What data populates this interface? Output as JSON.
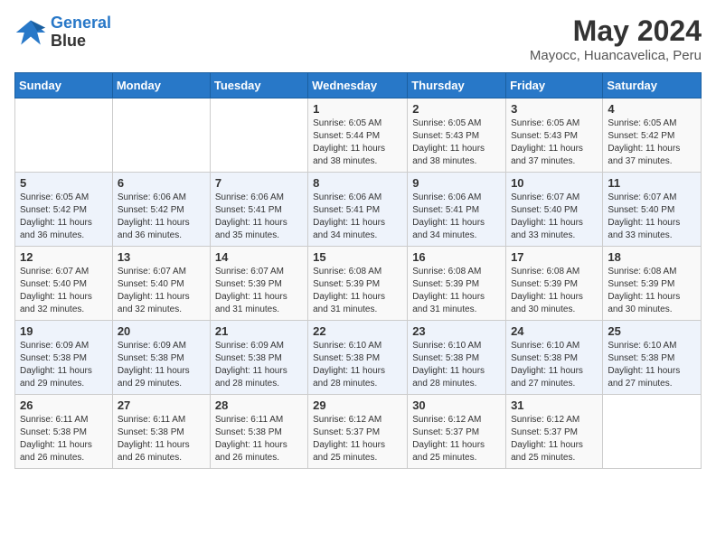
{
  "logo": {
    "line1": "General",
    "line2": "Blue"
  },
  "title": "May 2024",
  "location": "Mayocc, Huancavelica, Peru",
  "weekdays": [
    "Sunday",
    "Monday",
    "Tuesday",
    "Wednesday",
    "Thursday",
    "Friday",
    "Saturday"
  ],
  "weeks": [
    [
      {
        "day": "",
        "info": ""
      },
      {
        "day": "",
        "info": ""
      },
      {
        "day": "",
        "info": ""
      },
      {
        "day": "1",
        "info": "Sunrise: 6:05 AM\nSunset: 5:44 PM\nDaylight: 11 hours\nand 38 minutes."
      },
      {
        "day": "2",
        "info": "Sunrise: 6:05 AM\nSunset: 5:43 PM\nDaylight: 11 hours\nand 38 minutes."
      },
      {
        "day": "3",
        "info": "Sunrise: 6:05 AM\nSunset: 5:43 PM\nDaylight: 11 hours\nand 37 minutes."
      },
      {
        "day": "4",
        "info": "Sunrise: 6:05 AM\nSunset: 5:42 PM\nDaylight: 11 hours\nand 37 minutes."
      }
    ],
    [
      {
        "day": "5",
        "info": "Sunrise: 6:05 AM\nSunset: 5:42 PM\nDaylight: 11 hours\nand 36 minutes."
      },
      {
        "day": "6",
        "info": "Sunrise: 6:06 AM\nSunset: 5:42 PM\nDaylight: 11 hours\nand 36 minutes."
      },
      {
        "day": "7",
        "info": "Sunrise: 6:06 AM\nSunset: 5:41 PM\nDaylight: 11 hours\nand 35 minutes."
      },
      {
        "day": "8",
        "info": "Sunrise: 6:06 AM\nSunset: 5:41 PM\nDaylight: 11 hours\nand 34 minutes."
      },
      {
        "day": "9",
        "info": "Sunrise: 6:06 AM\nSunset: 5:41 PM\nDaylight: 11 hours\nand 34 minutes."
      },
      {
        "day": "10",
        "info": "Sunrise: 6:07 AM\nSunset: 5:40 PM\nDaylight: 11 hours\nand 33 minutes."
      },
      {
        "day": "11",
        "info": "Sunrise: 6:07 AM\nSunset: 5:40 PM\nDaylight: 11 hours\nand 33 minutes."
      }
    ],
    [
      {
        "day": "12",
        "info": "Sunrise: 6:07 AM\nSunset: 5:40 PM\nDaylight: 11 hours\nand 32 minutes."
      },
      {
        "day": "13",
        "info": "Sunrise: 6:07 AM\nSunset: 5:40 PM\nDaylight: 11 hours\nand 32 minutes."
      },
      {
        "day": "14",
        "info": "Sunrise: 6:07 AM\nSunset: 5:39 PM\nDaylight: 11 hours\nand 31 minutes."
      },
      {
        "day": "15",
        "info": "Sunrise: 6:08 AM\nSunset: 5:39 PM\nDaylight: 11 hours\nand 31 minutes."
      },
      {
        "day": "16",
        "info": "Sunrise: 6:08 AM\nSunset: 5:39 PM\nDaylight: 11 hours\nand 31 minutes."
      },
      {
        "day": "17",
        "info": "Sunrise: 6:08 AM\nSunset: 5:39 PM\nDaylight: 11 hours\nand 30 minutes."
      },
      {
        "day": "18",
        "info": "Sunrise: 6:08 AM\nSunset: 5:39 PM\nDaylight: 11 hours\nand 30 minutes."
      }
    ],
    [
      {
        "day": "19",
        "info": "Sunrise: 6:09 AM\nSunset: 5:38 PM\nDaylight: 11 hours\nand 29 minutes."
      },
      {
        "day": "20",
        "info": "Sunrise: 6:09 AM\nSunset: 5:38 PM\nDaylight: 11 hours\nand 29 minutes."
      },
      {
        "day": "21",
        "info": "Sunrise: 6:09 AM\nSunset: 5:38 PM\nDaylight: 11 hours\nand 28 minutes."
      },
      {
        "day": "22",
        "info": "Sunrise: 6:10 AM\nSunset: 5:38 PM\nDaylight: 11 hours\nand 28 minutes."
      },
      {
        "day": "23",
        "info": "Sunrise: 6:10 AM\nSunset: 5:38 PM\nDaylight: 11 hours\nand 28 minutes."
      },
      {
        "day": "24",
        "info": "Sunrise: 6:10 AM\nSunset: 5:38 PM\nDaylight: 11 hours\nand 27 minutes."
      },
      {
        "day": "25",
        "info": "Sunrise: 6:10 AM\nSunset: 5:38 PM\nDaylight: 11 hours\nand 27 minutes."
      }
    ],
    [
      {
        "day": "26",
        "info": "Sunrise: 6:11 AM\nSunset: 5:38 PM\nDaylight: 11 hours\nand 26 minutes."
      },
      {
        "day": "27",
        "info": "Sunrise: 6:11 AM\nSunset: 5:38 PM\nDaylight: 11 hours\nand 26 minutes."
      },
      {
        "day": "28",
        "info": "Sunrise: 6:11 AM\nSunset: 5:38 PM\nDaylight: 11 hours\nand 26 minutes."
      },
      {
        "day": "29",
        "info": "Sunrise: 6:12 AM\nSunset: 5:37 PM\nDaylight: 11 hours\nand 25 minutes."
      },
      {
        "day": "30",
        "info": "Sunrise: 6:12 AM\nSunset: 5:37 PM\nDaylight: 11 hours\nand 25 minutes."
      },
      {
        "day": "31",
        "info": "Sunrise: 6:12 AM\nSunset: 5:37 PM\nDaylight: 11 hours\nand 25 minutes."
      },
      {
        "day": "",
        "info": ""
      }
    ]
  ]
}
